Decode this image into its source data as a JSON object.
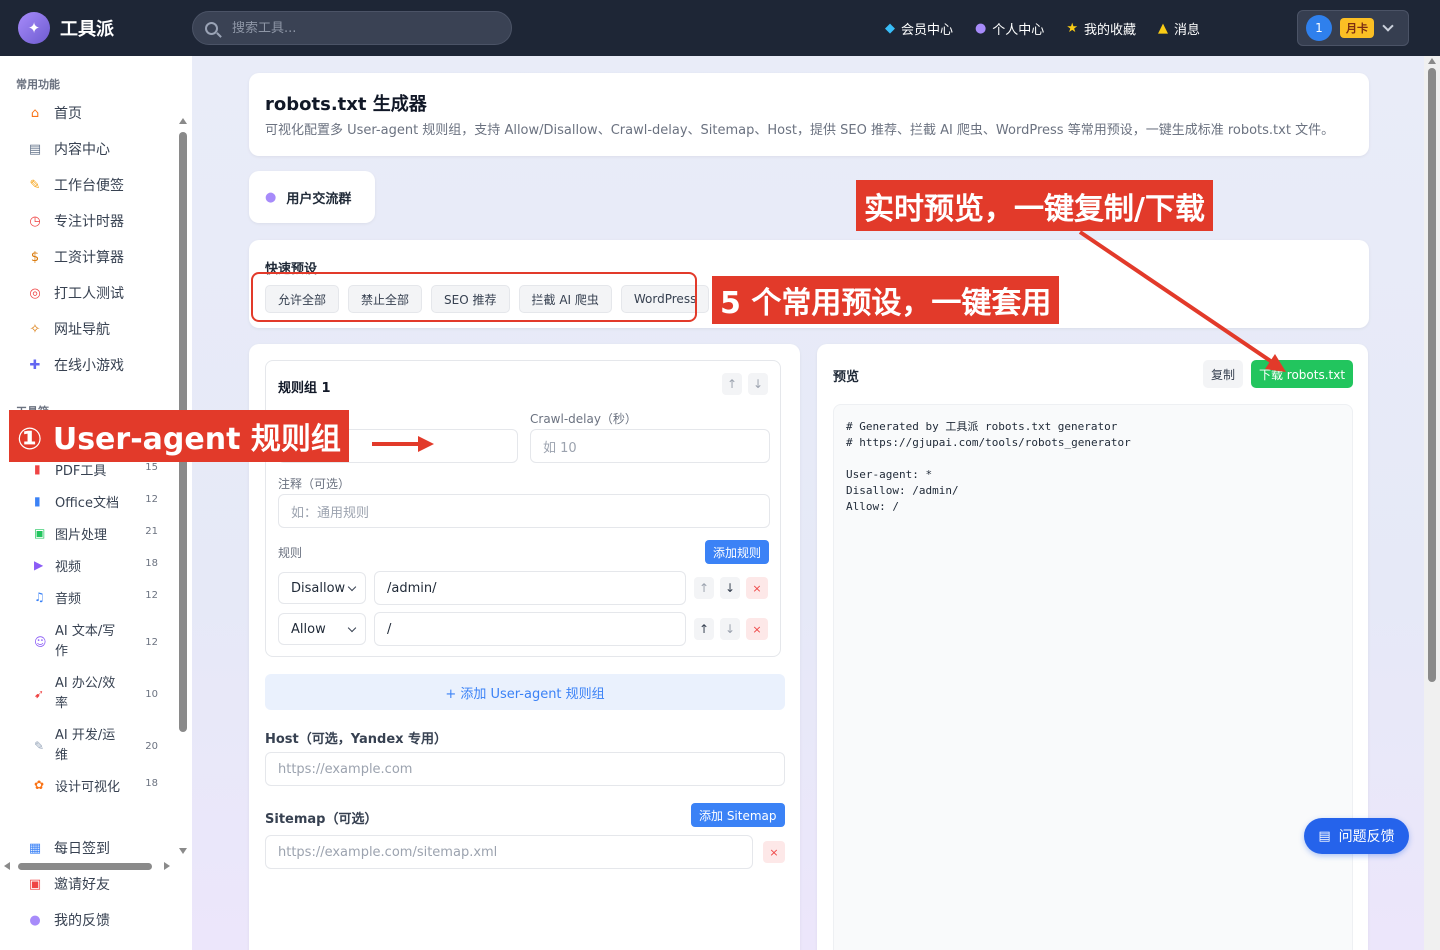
{
  "app": {
    "name": "工具派"
  },
  "search": {
    "placeholder": "搜索工具..."
  },
  "topnav": {
    "items": [
      {
        "label": "会员中心"
      },
      {
        "label": "个人中心"
      },
      {
        "label": "我的收藏"
      },
      {
        "label": "消息"
      }
    ],
    "avatar_number": "1",
    "vip_label": "月卡"
  },
  "sidebar": {
    "common_title": "常用功能",
    "common": [
      {
        "label": "首页"
      },
      {
        "label": "内容中心"
      },
      {
        "label": "工作台便签"
      },
      {
        "label": "专注计时器"
      },
      {
        "label": "工资计算器"
      },
      {
        "label": "打工人测试"
      },
      {
        "label": "网址导航"
      },
      {
        "label": "在线小游戏"
      }
    ],
    "tools_title": "工具箱",
    "categories": [
      {
        "label": "PDF工具",
        "count": "15"
      },
      {
        "label": "Office文档",
        "count": "12"
      },
      {
        "label": "图片处理",
        "count": "21"
      },
      {
        "label": "视频",
        "count": "18"
      },
      {
        "label": "音频",
        "count": "12"
      },
      {
        "label": "AI 文本/写作",
        "count": "12"
      },
      {
        "label": "AI 办公/效率",
        "count": "10"
      },
      {
        "label": "AI 开发/运维",
        "count": "20"
      },
      {
        "label": "设计可视化",
        "count": "18"
      }
    ],
    "bottom": [
      {
        "label": "每日签到"
      },
      {
        "label": "邀请好友"
      },
      {
        "label": "我的反馈"
      }
    ]
  },
  "page": {
    "title": "robots.txt 生成器",
    "description": "可视化配置多 User-agent 规则组，支持 Allow/Disallow、Crawl-delay、Sitemap、Host，提供 SEO 推荐、拦截 AI 爬虫、WordPress 等常用预设，一键生成标准 robots.txt 文件。",
    "group_chat": "用户交流群"
  },
  "presets": {
    "label": "快速预设",
    "buttons": [
      "允许全部",
      "禁止全部",
      "SEO 推荐",
      "拦截 AI 爬虫",
      "WordPress"
    ]
  },
  "rule_group": {
    "title": "规则组 1",
    "crawl_delay_label": "Crawl-delay（秒）",
    "crawl_delay_placeholder": "如 10",
    "comment_label": "注释（可选）",
    "comment_placeholder": "如：通用规则",
    "rules_label": "规则",
    "add_rule": "添加规则",
    "rules": [
      {
        "type": "Disallow",
        "path": "/admin/"
      },
      {
        "type": "Allow",
        "path": "/"
      }
    ]
  },
  "add_group": "+ 添加 User-agent 规则组",
  "host": {
    "label": "Host（可选，Yandex 专用）",
    "placeholder": "https://example.com"
  },
  "sitemap": {
    "label": "Sitemap（可选）",
    "add_label": "添加 Sitemap",
    "placeholder": "https://example.com/sitemap.xml"
  },
  "preview": {
    "title": "预览",
    "copy": "复制",
    "download": "下载 robots.txt",
    "code": "# Generated by 工具派 robots.txt generator\n# https://gjupai.com/tools/robots_generator\n\nUser-agent: *\nDisallow: /admin/\nAllow: /"
  },
  "feedback": "问题反馈",
  "annotations": {
    "a1": "① User-agent 规则组",
    "a2": "5 个常用预设，一键套用",
    "a3": "实时预览，一键复制/下载"
  },
  "colors": {
    "accent": "#3b82f6",
    "success": "#22c55e",
    "annotation": "#e23a2a",
    "topbar": "#1e2636"
  }
}
